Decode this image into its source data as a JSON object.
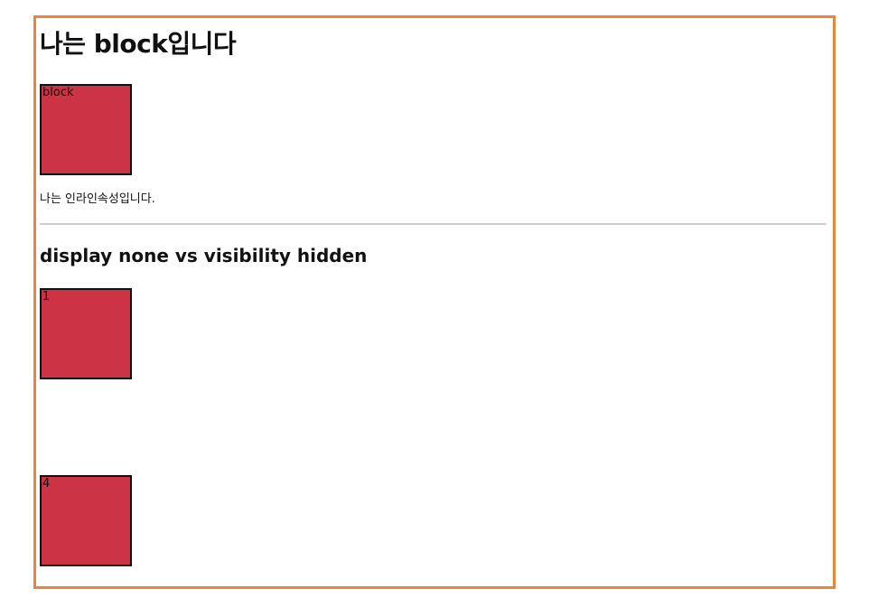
{
  "page": {
    "title": "나는 block입니다",
    "block_box_label": "block",
    "inline_text": "나는 인라인속성입니다.",
    "section_title": "display none vs visibility hidden"
  },
  "boxes": [
    {
      "label": "1"
    },
    {
      "label": "4"
    }
  ],
  "colors": {
    "frame_border": "#e8853a",
    "box_fill": "#cc3344",
    "box_border": "#111111",
    "divider": "#cccccc"
  }
}
